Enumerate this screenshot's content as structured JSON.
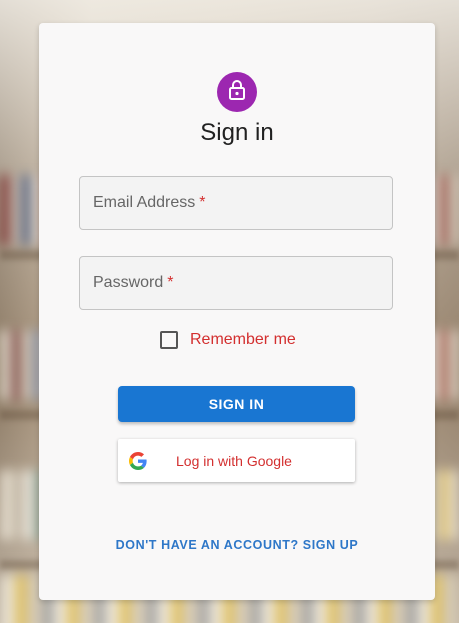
{
  "page": {
    "title": "Sign in"
  },
  "form": {
    "email_label": "Email Address",
    "password_label": "Password",
    "required_mark": "*",
    "remember_label": "Remember me",
    "remember_checked": false
  },
  "buttons": {
    "signin_label": "SIGN IN",
    "google_label": "Log in with Google",
    "signup_label": "DON'T HAVE AN ACCOUNT? SIGN UP"
  },
  "icons": {
    "avatar": "lock-icon",
    "google": "google-icon"
  },
  "colors": {
    "avatar_bg": "#9c27b0",
    "primary": "#1976d2",
    "error": "#d32f2f",
    "link": "#2e77c8"
  }
}
